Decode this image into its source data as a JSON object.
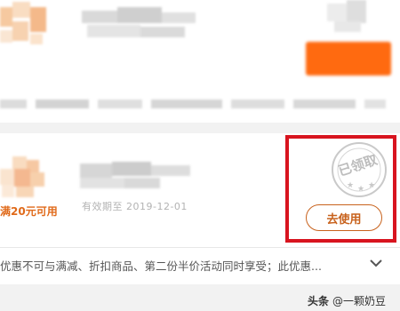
{
  "coupon_bottom": {
    "condition": "满20元可用",
    "expiry": "有效期至 2019-12-01",
    "stamp_text": "已领取",
    "use_button": "去使用",
    "description": "优惠不可与满减、折扣商品、第二份半价活动同时享受；此优惠..."
  },
  "watermark": {
    "platform": "头条",
    "author": "@一颗奶豆"
  },
  "colors": {
    "accent": "#ff6a10",
    "button_border": "#c8621d",
    "highlight": "#d8141f"
  },
  "icons": [
    "chevron-down-icon",
    "stamp-icon",
    "at-icon"
  ]
}
